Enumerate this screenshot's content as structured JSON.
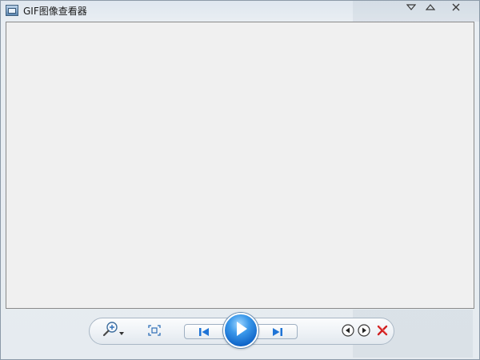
{
  "window": {
    "title": "GIF图像查看器"
  },
  "icons": {
    "app": "image-viewer-icon",
    "caption_menu": "chevron-down-icon",
    "caption_up": "chevron-up-icon",
    "close": "close-icon",
    "zoom": "magnifier-plus-icon",
    "zoom_dropdown": "triangle-down-icon",
    "fit": "fit-to-window-icon",
    "prev": "skip-previous-icon",
    "play": "play-icon",
    "next": "skip-next-icon",
    "rotate_left": "rotate-counterclockwise-icon",
    "rotate_right": "rotate-clockwise-icon",
    "delete": "delete-x-icon"
  },
  "colors": {
    "accent": "#1f74d6",
    "delete": "#d02020",
    "viewer_bg": "#f0f0f0"
  }
}
